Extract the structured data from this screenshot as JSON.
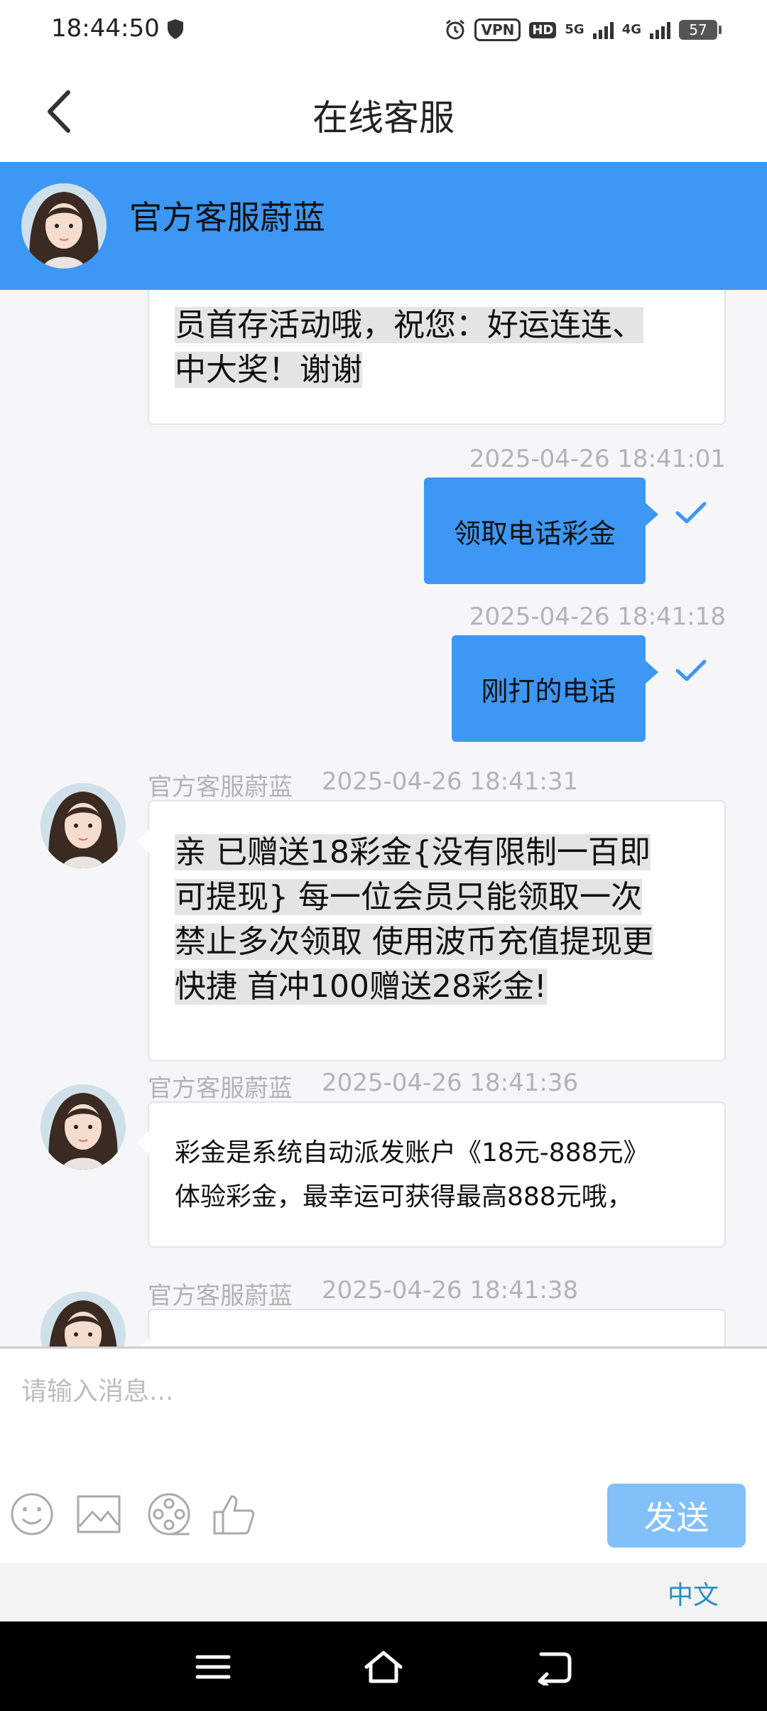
{
  "status_bar": {
    "time": "18:44:50",
    "vpn": "VPN",
    "hd": "HD",
    "net1": "5G",
    "net2": "4G",
    "battery": "57"
  },
  "header": {
    "title": "在线客服"
  },
  "banner": {
    "agent_name": "官方客服蔚蓝"
  },
  "messages": [
    {
      "type": "incoming-partial",
      "lines": [
        "员首存活动哦，祝您：好运连连、",
        "中大奖！谢谢"
      ]
    },
    {
      "type": "outgoing",
      "timestamp": "2025-04-26 18:41:01",
      "text": "领取电话彩金"
    },
    {
      "type": "outgoing",
      "timestamp": "2025-04-26 18:41:18",
      "text": "刚打的电话"
    },
    {
      "type": "incoming",
      "sender": "官方客服蔚蓝",
      "timestamp": "2025-04-26 18:41:31",
      "lines": [
        "亲 已赠送18彩金{没有限制一百即",
        "可提现} 每一位会员只能领取一次",
        "禁止多次领取 使用波币充值提现更",
        "快捷 首冲100赠送28彩金!"
      ]
    },
    {
      "type": "incoming",
      "sender": "官方客服蔚蓝",
      "timestamp": "2025-04-26 18:41:36",
      "lines": [
        "彩金是系统自动派发账户《18元-888元》",
        "体验彩金，最幸运可获得最高888元哦，"
      ]
    },
    {
      "type": "incoming",
      "sender": "官方客服蔚蓝",
      "timestamp": "2025-04-26 18:41:38",
      "lines": []
    }
  ],
  "input": {
    "placeholder": "请输入消息..."
  },
  "toolbar": {
    "send_label": "发送"
  },
  "language": {
    "label": "中文"
  },
  "colors": {
    "accent": "#3d97f4",
    "send_disabled": "#82c0fa",
    "timestamp": "#b3b3b3"
  }
}
